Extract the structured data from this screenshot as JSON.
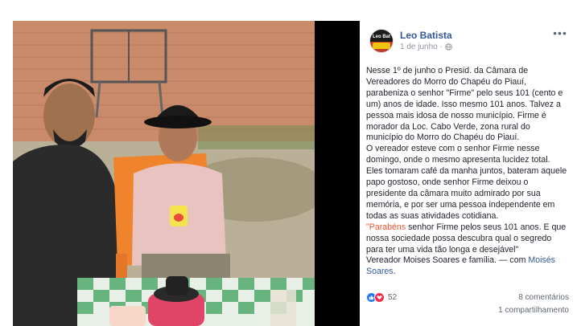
{
  "photo": {
    "description_icon": "photo"
  },
  "post": {
    "author": "Leo Batista",
    "avatar_text": "Leo Bat",
    "date": "1 de junho",
    "date_separator": "·",
    "privacy_icon": "globe-icon",
    "more_label": "•••",
    "paragraph_1": "Nesse 1º de junho o Presid. da Câmara de Vereadores do Morro do Chapéu do Piauí, parabeniza o senhor \"Firme\" pelo seus 101 (cento e um) anos de idade. Isso mesmo 101 anos. Talvez a pessoa mais idosa de nosso município. Firme é morador da Loc. Cabo Verde, zona rural do município do Morro do Chapéu do Piauí.",
    "paragraph_2": "O vereador esteve com o senhor Firme nesse domingo, onde o mesmo apresenta lucidez total. Eles tomaram café da manha juntos, bateram aquele papo gostoso, onde senhor Firme deixou o presidente da câmara muito admirado por sua memória, e por ser uma pessoa independente em todas as suas atividades cotidiana.",
    "paragraph_3_quote_open": "\"",
    "paragraph_3_highlight": "Parabéns",
    "paragraph_3_rest": " senhor Firme pelos seus 101 anos. E que nossa sociedade possa descubra qual o segredo para ter uma vida tão longa e desejável\"",
    "paragraph_4_text": "Vereador Moises Soares e família. — com ",
    "paragraph_4_mention": "Moisés Soares",
    "paragraph_4_end": "."
  },
  "footer": {
    "reaction_count": "52",
    "comments": "8 comentários",
    "shares": "1 compartilhamento"
  },
  "colors": {
    "link": "#365899",
    "highlight": "#f0532d",
    "like": "#2078f4",
    "love": "#f0284a"
  }
}
